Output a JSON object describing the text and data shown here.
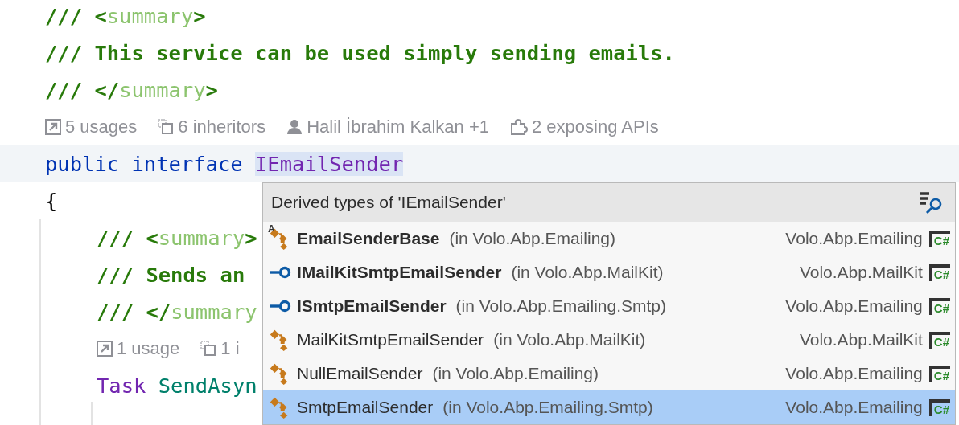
{
  "editor": {
    "lines": [
      {
        "kind": "code",
        "tokens": [
          {
            "text": "/// <",
            "kind": "doc"
          },
          {
            "text": "summary",
            "kind": "doc-tag"
          },
          {
            "text": ">",
            "kind": "doc"
          }
        ]
      },
      {
        "kind": "code",
        "tokens": [
          {
            "text": "/// This service can be used simply sending emails.",
            "kind": "doc"
          }
        ]
      },
      {
        "kind": "code",
        "tokens": [
          {
            "text": "/// </",
            "kind": "doc"
          },
          {
            "text": "summary",
            "kind": "doc-tag"
          },
          {
            "text": ">",
            "kind": "doc"
          }
        ]
      },
      {
        "kind": "lens",
        "items": [
          {
            "kind": "usages",
            "text": "5 usages"
          },
          {
            "kind": "inheritors",
            "text": "6 inheritors"
          },
          {
            "kind": "author",
            "text": "Halil İbrahim Kalkan +1"
          },
          {
            "kind": "api",
            "text": "2 exposing APIs"
          }
        ]
      },
      {
        "kind": "code",
        "highlighted": true,
        "tokens": [
          {
            "text": "public ",
            "kind": "keyword"
          },
          {
            "text": "interface ",
            "kind": "keyword"
          },
          {
            "text": "IEmailSender",
            "kind": "interface",
            "highlighted": true
          }
        ]
      },
      {
        "kind": "code",
        "tokens": [
          {
            "text": "{",
            "kind": "plain"
          }
        ],
        "children": [
          {
            "kind": "code",
            "tokens": [
              {
                "text": "/// <",
                "kind": "doc"
              },
              {
                "text": "summary",
                "kind": "doc-tag"
              },
              {
                "text": ">",
                "kind": "doc"
              }
            ]
          },
          {
            "kind": "code",
            "tokens": [
              {
                "text": "/// Sends an",
                "kind": "doc"
              }
            ]
          },
          {
            "kind": "code",
            "tokens": [
              {
                "text": "/// </",
                "kind": "doc"
              },
              {
                "text": "summary",
                "kind": "doc-tag"
              }
            ]
          },
          {
            "kind": "lens",
            "items": [
              {
                "kind": "usages",
                "text": "1 usage"
              },
              {
                "kind": "inheritors",
                "text": "1 i"
              }
            ]
          },
          {
            "kind": "code",
            "tokens": [
              {
                "text": "Task ",
                "kind": "class"
              },
              {
                "text": "SendAsyn",
                "kind": "method"
              }
            ]
          }
        ]
      }
    ]
  },
  "popup": {
    "title": "Derived types of 'IEmailSender'",
    "rows": [
      {
        "kind": "abstract-class",
        "icon_text": "A",
        "name": "EmailSenderBase",
        "bold": true,
        "location": "(in Volo.Abp.Emailing)",
        "assembly": "Volo.Abp.Emailing",
        "lang": "C#",
        "selected": false
      },
      {
        "kind": "interface",
        "name": "IMailKitSmtpEmailSender",
        "bold": true,
        "location": "(in Volo.Abp.MailKit)",
        "assembly": "Volo.Abp.MailKit",
        "lang": "C#",
        "selected": false
      },
      {
        "kind": "interface",
        "name": "ISmtpEmailSender",
        "bold": true,
        "location": "(in Volo.Abp.Emailing.Smtp)",
        "assembly": "Volo.Abp.Emailing",
        "lang": "C#",
        "selected": false
      },
      {
        "kind": "class",
        "name": "MailKitSmtpEmailSender",
        "bold": false,
        "location": "(in Volo.Abp.MailKit)",
        "assembly": "Volo.Abp.MailKit",
        "lang": "C#",
        "selected": false
      },
      {
        "kind": "class",
        "name": "NullEmailSender",
        "bold": false,
        "location": "(in Volo.Abp.Emailing)",
        "assembly": "Volo.Abp.Emailing",
        "lang": "C#",
        "selected": false
      },
      {
        "kind": "class",
        "name": "SmtpEmailSender",
        "bold": false,
        "location": "(in Volo.Abp.Emailing.Smtp)",
        "assembly": "Volo.Abp.Emailing",
        "lang": "C#",
        "selected": true
      }
    ]
  }
}
